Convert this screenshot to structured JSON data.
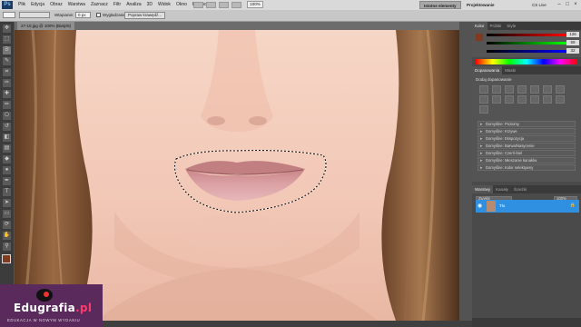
{
  "menubar": {
    "app_logo": "Ps",
    "items": [
      "Plik",
      "Edycja",
      "Obraz",
      "Warstwa",
      "Zaznacz",
      "Filtr",
      "Analiza",
      "3D",
      "Widok",
      "Okno",
      "Pomoc"
    ],
    "zoom": "100%",
    "workspace_active": "Istotne elementy",
    "workspace_other": "Projektowanie",
    "cs_live": "CS Live"
  },
  "options_bar": {
    "feather_label": "Wtapianie:",
    "feather_value": "0 px",
    "antialias_label": "Wygładzanie",
    "refine_button": "Popraw krawędź..."
  },
  "document": {
    "tab_title": "27-10.jpg @ 100% (Biały/8)"
  },
  "panels": {
    "color_tabs": [
      "Kolor",
      "Próbki",
      "Style"
    ],
    "color_sliders": [
      {
        "label": "R",
        "value": "126"
      },
      {
        "label": "G",
        "value": "59"
      },
      {
        "label": "B",
        "value": "32"
      }
    ],
    "adjust_tabs": [
      "Dopasowania",
      "Maski"
    ],
    "adjust_title": "Dodaj dopasowanie",
    "presets": [
      "Domyślne: Poziomy",
      "Domyślne: Krzywe",
      "Domyślne: Ekspozycja",
      "Domyślne: Barwa/Nasycenie",
      "Domyślne: Czerń-biel",
      "Domyślne: Mieszanie kanałów",
      "Domyślne: Kolor selektywny"
    ],
    "layers_tabs": [
      "Warstwy",
      "Kanały",
      "Ścieżki"
    ],
    "blend_mode": "Zwykły",
    "opacity": "100%",
    "fill": "100%",
    "layer_name": "Tło",
    "layer_lock": "🔒"
  },
  "branding": {
    "name_main": "Edugrafia",
    "name_tld": ".pl",
    "tagline": "EDUKACJA W NOWYM WYDANIU"
  },
  "colors": {
    "skin": "#f3c9b9",
    "lips": "#d89aa0",
    "hair": "#7d5233",
    "selection_blue": "#2f8fe0",
    "logo_bg": "#5a2a5c"
  },
  "icons": [
    "photoshop-logo",
    "move-tool-icon",
    "marquee-tool-icon",
    "lasso-tool-icon",
    "brush-tool-icon",
    "eye-icon",
    "lock-icon"
  ]
}
